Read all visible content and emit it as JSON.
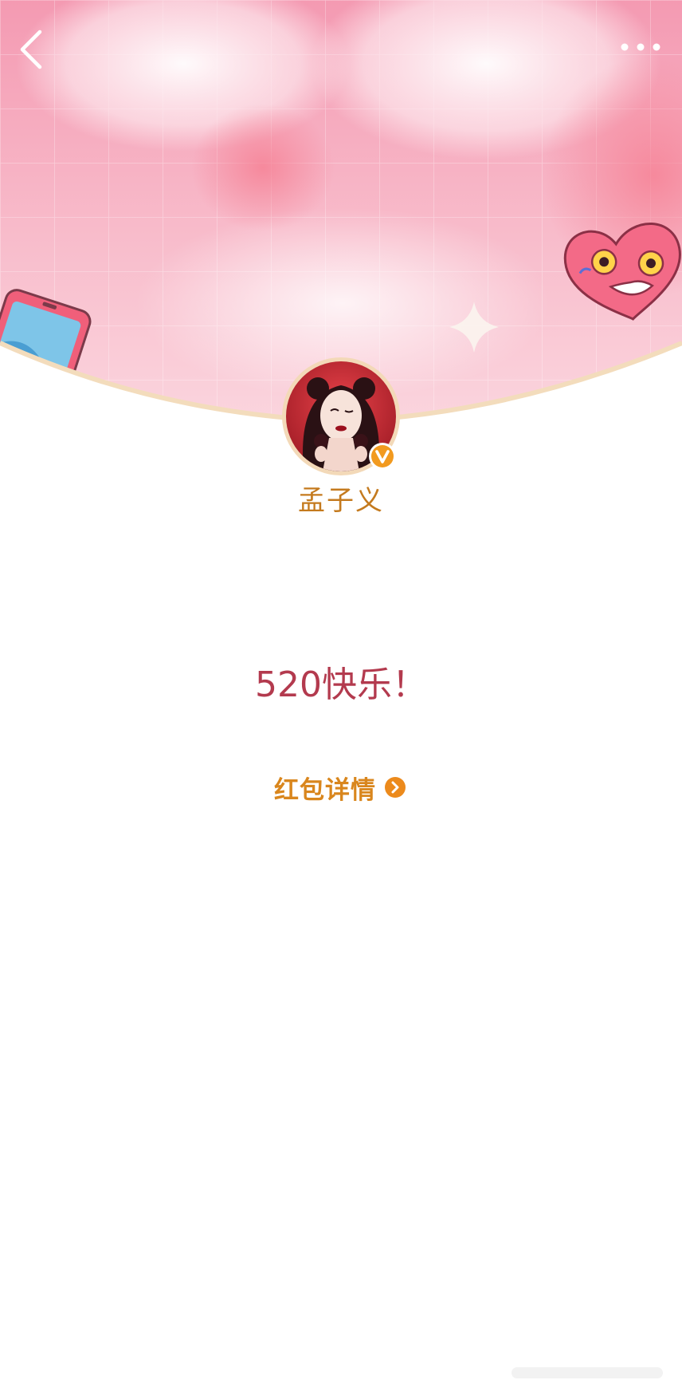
{
  "header": {
    "back_icon": "chevron-left-icon",
    "more_icon": "more-horizontal-icon"
  },
  "profile": {
    "username": "孟子义",
    "verified_icon": "verified-v-badge-icon"
  },
  "message": {
    "text": "520快乐！"
  },
  "details": {
    "label": "红包详情",
    "icon": "chevron-right-circle-icon"
  },
  "colors": {
    "username": "#c47a1e",
    "message": "#b33a4e",
    "details_link": "#d9861d",
    "banner_pink": "#f7a9bd",
    "badge_orange": "#f29a1f"
  }
}
